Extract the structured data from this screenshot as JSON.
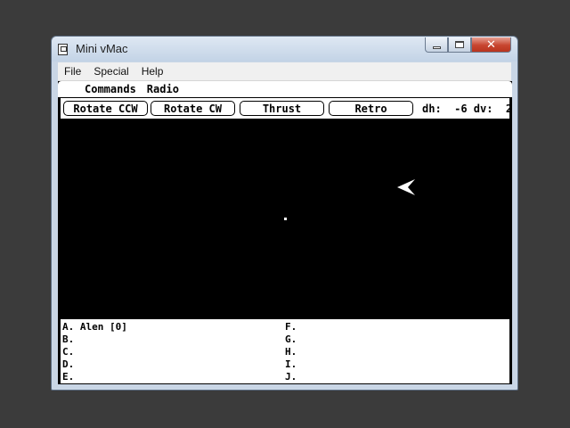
{
  "window": {
    "title": "Mini vMac",
    "icon": "mini-vmac-icon",
    "controls": [
      "minimize-icon",
      "maximize-icon",
      "close-icon"
    ],
    "close_glyph": "✕"
  },
  "host_menu": [
    "File",
    "Special",
    "Help"
  ],
  "mac_menu": [
    "Commands",
    "Radio"
  ],
  "toolbar": {
    "buttons": [
      "Rotate CCW",
      "Rotate CW",
      "Thrust",
      "Retro"
    ],
    "readout": "dh:  -6 dv:  2"
  },
  "players": {
    "left": [
      "A. Alen [0]",
      "B.",
      "C.",
      "D.",
      "E."
    ],
    "right": [
      "F.",
      "G.",
      "H.",
      "I.",
      "J."
    ]
  },
  "colors": {
    "space": "#000000",
    "ship": "#ffffff",
    "close_button": "#c7452f"
  }
}
